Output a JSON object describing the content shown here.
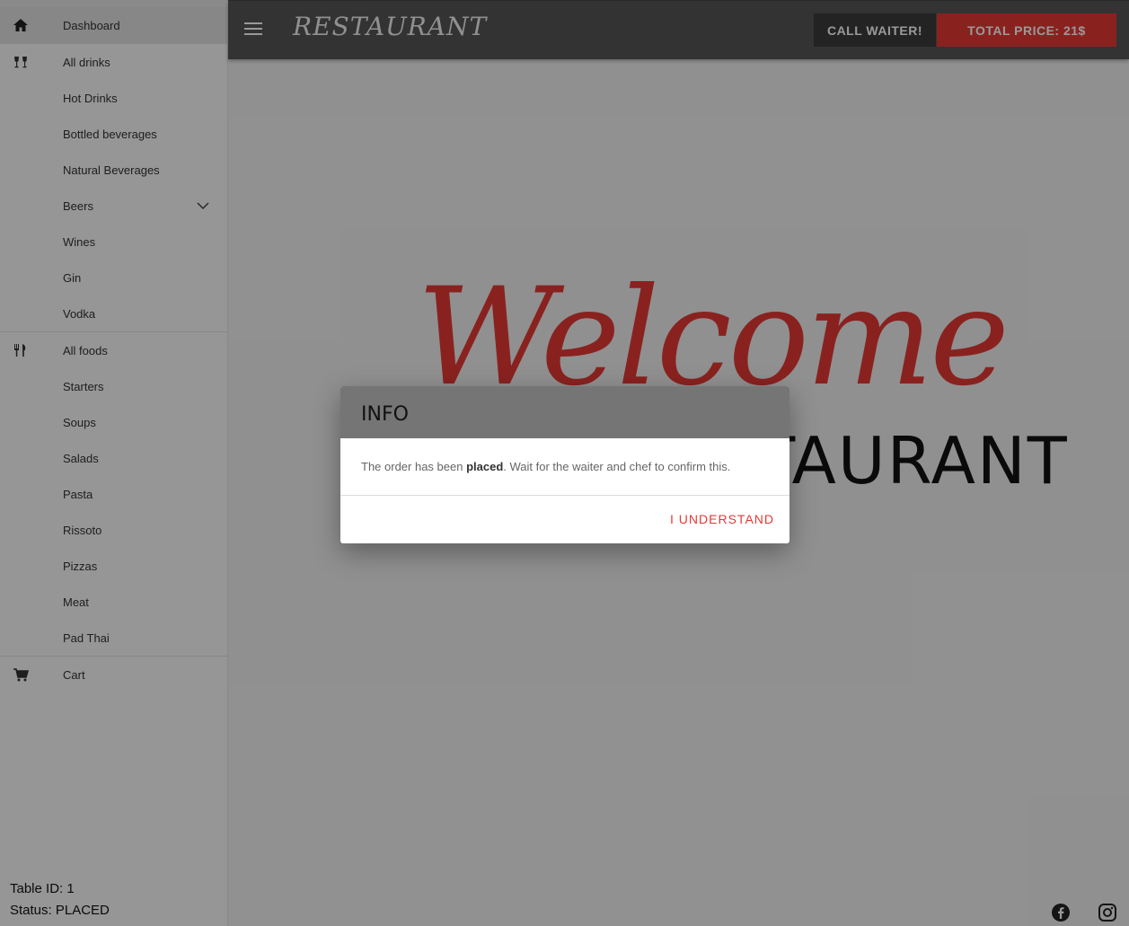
{
  "header": {
    "brand": "RESTAURANT",
    "call_waiter_label": "CALL WAITER!",
    "total_price_label": "TOTAL PRICE: 21$"
  },
  "sidebar": {
    "items": [
      {
        "label": "Dashboard",
        "icon": "home-icon"
      },
      {
        "label": "All drinks",
        "icon": "glasses-icon"
      },
      {
        "label": "Hot Drinks"
      },
      {
        "label": "Bottled beverages"
      },
      {
        "label": "Natural Beverages"
      },
      {
        "label": "Beers",
        "icon": "chevron-down-icon"
      },
      {
        "label": "Wines"
      },
      {
        "label": "Gin"
      },
      {
        "label": "Vodka"
      },
      {
        "label": "All foods",
        "icon": "utensils-icon"
      },
      {
        "label": "Starters"
      },
      {
        "label": "Soups"
      },
      {
        "label": "Salads"
      },
      {
        "label": "Pasta"
      },
      {
        "label": "Rissoto"
      },
      {
        "label": "Pizzas"
      },
      {
        "label": "Meat"
      },
      {
        "label": "Pad Thai"
      },
      {
        "label": "Cart",
        "icon": "cart-icon"
      }
    ],
    "table_id": "Table ID: 1",
    "status": "Status: PLACED"
  },
  "main": {
    "welcome_script": "Welcome",
    "welcome_sub": "RESTAURANT"
  },
  "dialog": {
    "title": "INFO",
    "message_before": "The order has been ",
    "message_bold": "placed",
    "message_after": ". Wait for the waiter and chef to confirm this.",
    "button_label": "I UNDERSTAND"
  },
  "colors": {
    "accent": "#e53935",
    "header_bg": "#555555",
    "dialog_head_bg": "#757575"
  },
  "social": [
    "facebook-icon",
    "instagram-icon"
  ]
}
